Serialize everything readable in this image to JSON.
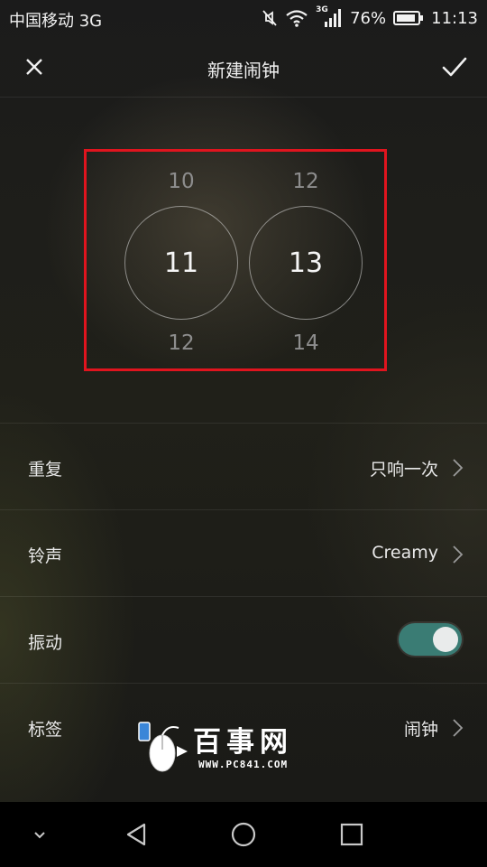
{
  "status_bar": {
    "carrier": "中国移动 3G",
    "network_tag": "3G",
    "battery_percent": "76%",
    "time": "11:13"
  },
  "header": {
    "title": "新建闹钟",
    "close_icon": "close-icon",
    "confirm_icon": "checkmark-icon"
  },
  "picker": {
    "hour": {
      "prev": "10",
      "current": "11",
      "next": "12"
    },
    "minute": {
      "prev": "12",
      "current": "13",
      "next": "14"
    }
  },
  "settings": {
    "repeat": {
      "label": "重复",
      "value": "只响一次"
    },
    "ringtone": {
      "label": "铃声",
      "value": "Creamy"
    },
    "vibrate": {
      "label": "振动",
      "enabled": true
    },
    "tag": {
      "label": "标签",
      "value": "闹钟"
    }
  },
  "watermark": {
    "text": "百事网",
    "url": "WWW.PC841.COM"
  },
  "colors": {
    "highlight_border": "#e0141e",
    "toggle_on": "#3a7c74"
  },
  "nav_bar": {
    "icons": [
      "chevron-down-icon",
      "back-triangle-icon",
      "home-circle-icon",
      "recents-square-icon"
    ]
  }
}
